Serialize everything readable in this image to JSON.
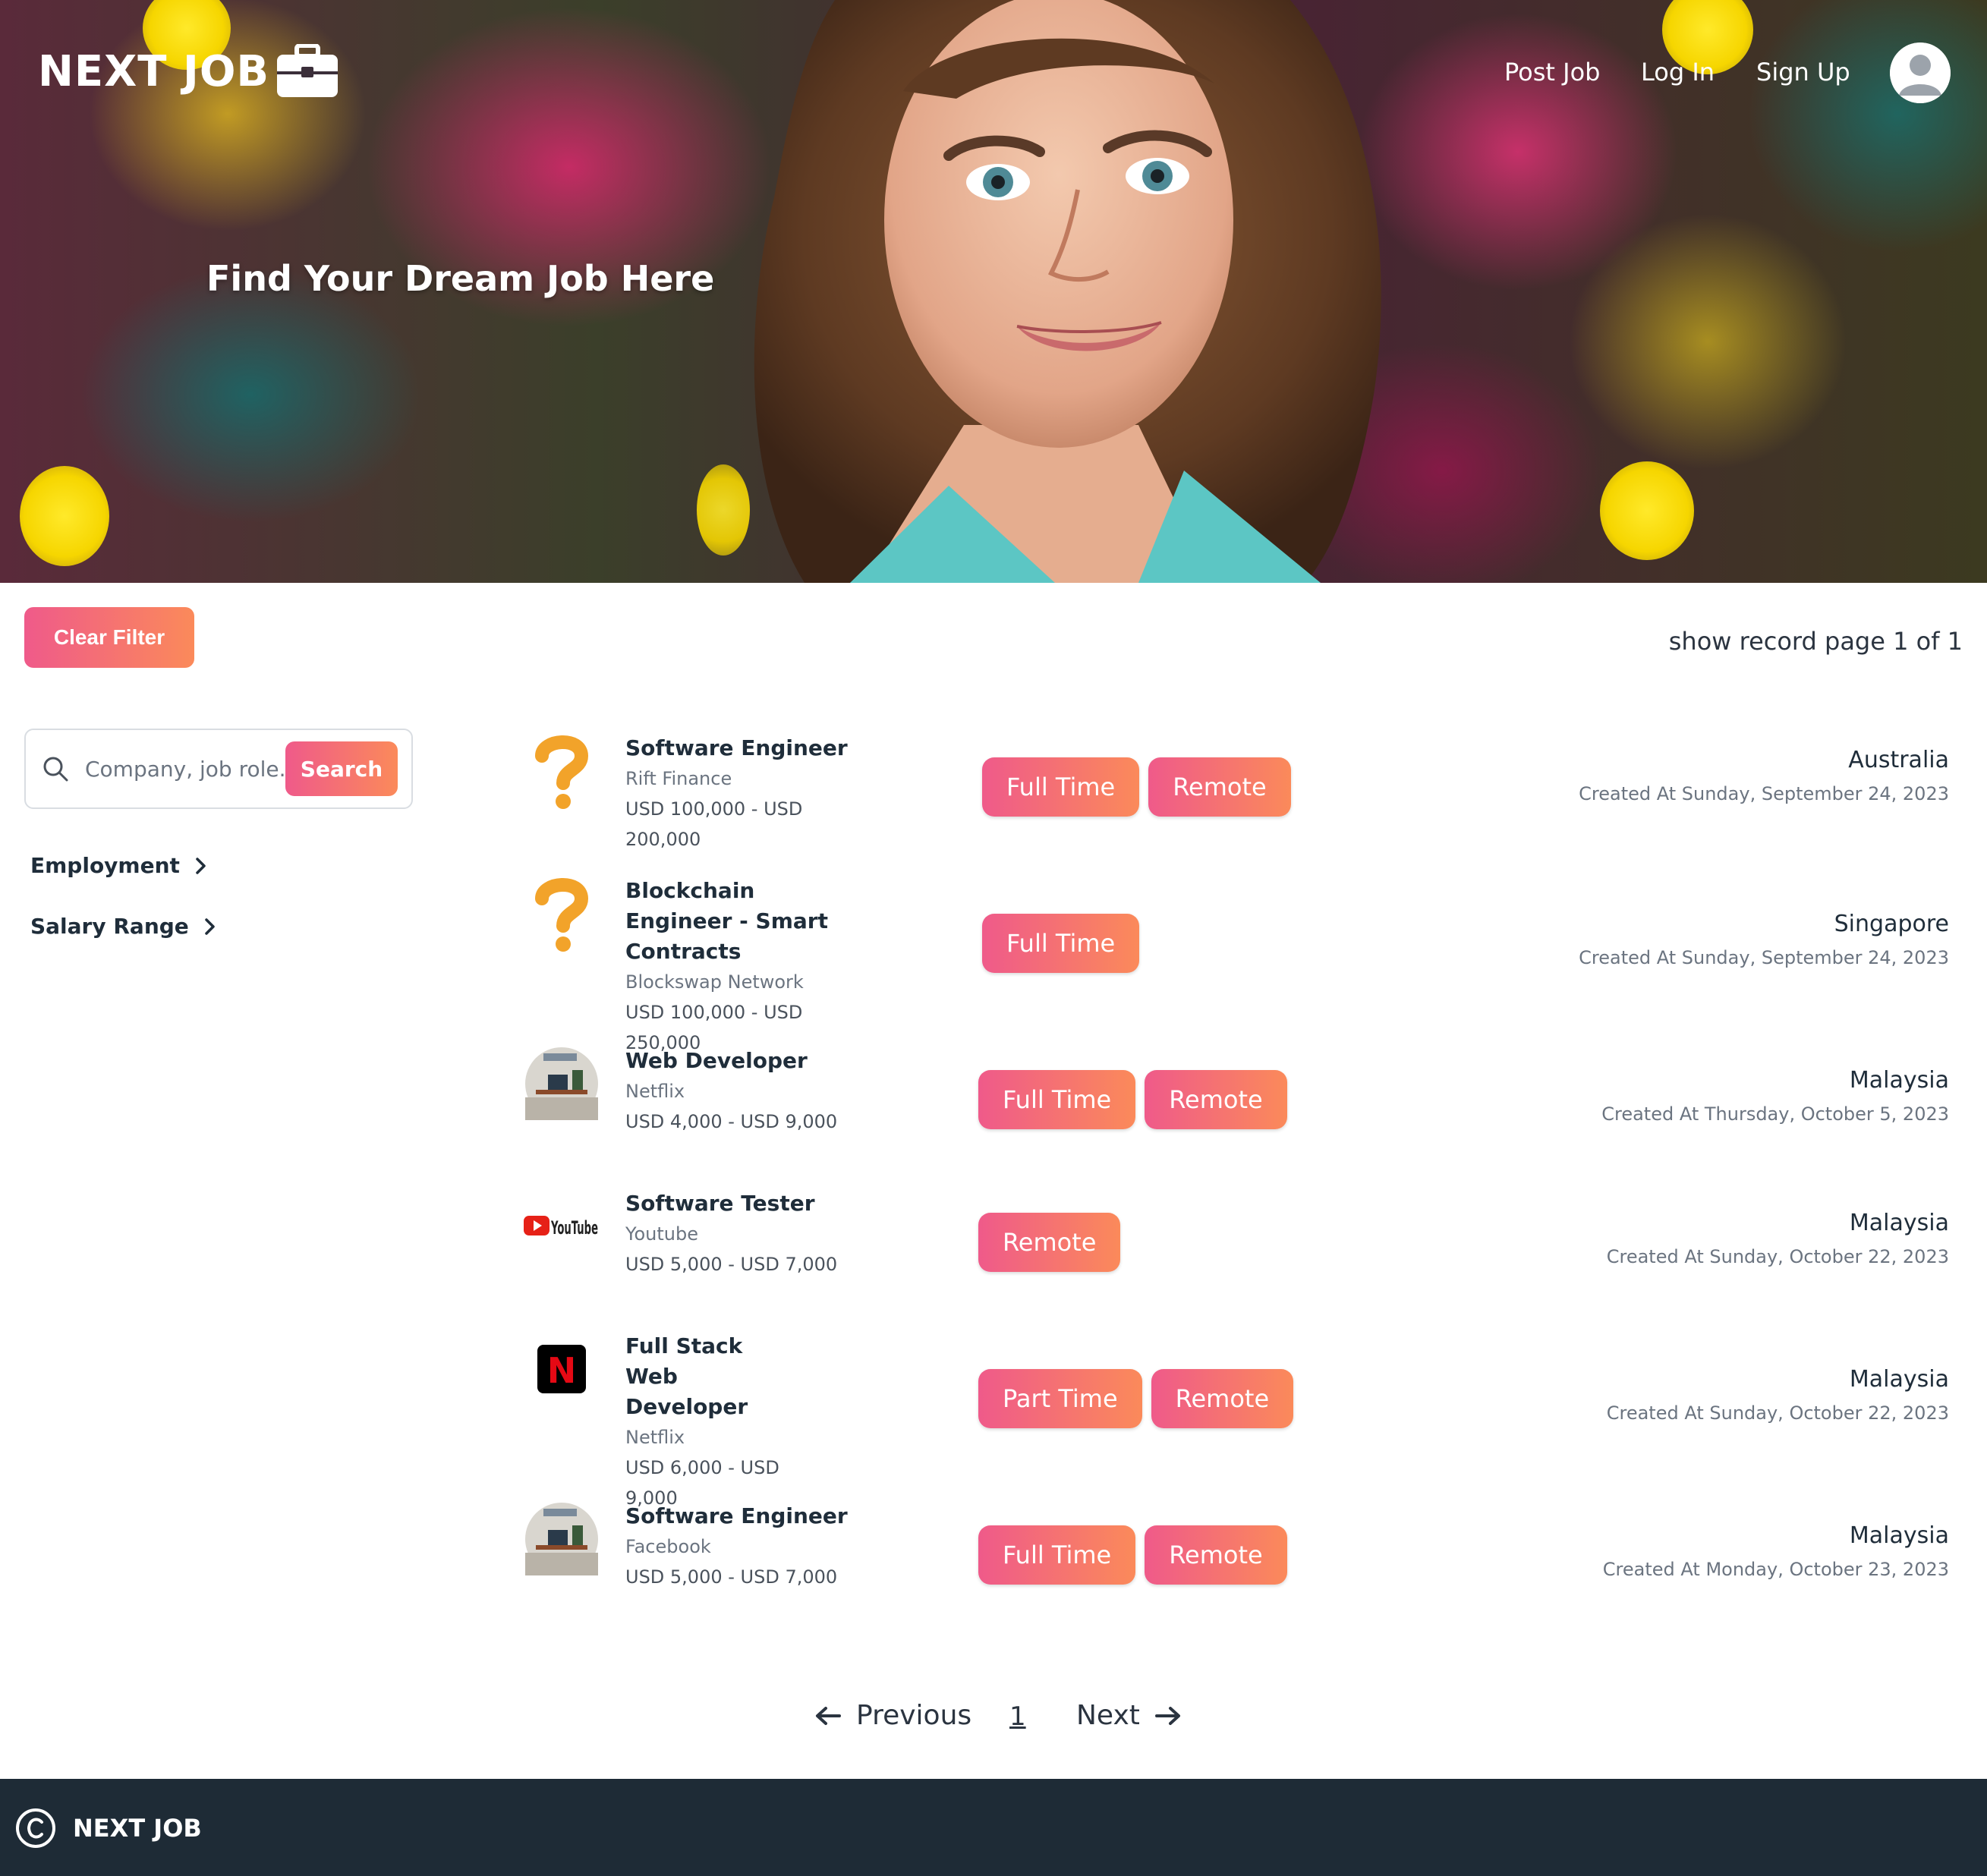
{
  "nav": {
    "logo": "NEXT JOB",
    "post_job": "Post Job",
    "log_in": "Log In",
    "sign_up": "Sign Up"
  },
  "hero": {
    "title": "Find Your Dream Job Here"
  },
  "toolbar": {
    "clear_filter": "Clear Filter",
    "record_info": "show record page 1 of 1"
  },
  "search": {
    "placeholder": "Company, job role...",
    "button": "Search"
  },
  "filters": [
    "Employment",
    "Salary Range"
  ],
  "jobs": [
    {
      "title": "Software Engineer",
      "company": "Rift Finance",
      "salary": "USD 100,000 - USD 200,000",
      "tags": [
        "Full Time",
        "Remote"
      ],
      "location": "Australia",
      "created": "Created At Sunday, September 24, 2023",
      "logo": "question-mark-icon"
    },
    {
      "title": "Blockchain Engineer - Smart Contracts",
      "company": "Blockswap Network",
      "salary": "USD 100,000 - USD 250,000",
      "tags": [
        "Full Time"
      ],
      "location": "Singapore",
      "created": "Created At Sunday, September 24, 2023",
      "logo": "question-mark-icon"
    },
    {
      "title": "Web Developer",
      "company": "Netflix",
      "salary": "USD 4,000 - USD 9,000",
      "tags": [
        "Full Time",
        "Remote"
      ],
      "location": "Malaysia",
      "created": "Created At Thursday, October 5, 2023",
      "logo": "desk-photo"
    },
    {
      "title": "Software Tester",
      "company": "Youtube",
      "salary": "USD 5,000 - USD 7,000",
      "tags": [
        "Remote"
      ],
      "location": "Malaysia",
      "created": "Created At Sunday, October 22, 2023",
      "logo": "youtube-logo",
      "logo_text": "YouTube"
    },
    {
      "title": "Full Stack Web Developer",
      "company": "Netflix",
      "salary": "USD 6,000 - USD 9,000",
      "tags": [
        "Part Time",
        "Remote"
      ],
      "location": "Malaysia",
      "created": "Created At Sunday, October 22, 2023",
      "logo": "netflix-logo",
      "logo_text": "N"
    },
    {
      "title": "Software Engineer",
      "company": "Facebook",
      "salary": "USD 5,000 - USD 7,000",
      "tags": [
        "Full Time",
        "Remote"
      ],
      "location": "Malaysia",
      "created": "Created At Monday, October 23, 2023",
      "logo": "desk-photo"
    }
  ],
  "pagination": {
    "previous": "Previous",
    "current": "1",
    "next": "Next"
  },
  "footer": {
    "brand": "NEXT JOB"
  },
  "colors": {
    "accent_start": "#ef5a8a",
    "accent_end": "#fb8a5a",
    "footer_bg": "#1e2b36"
  }
}
